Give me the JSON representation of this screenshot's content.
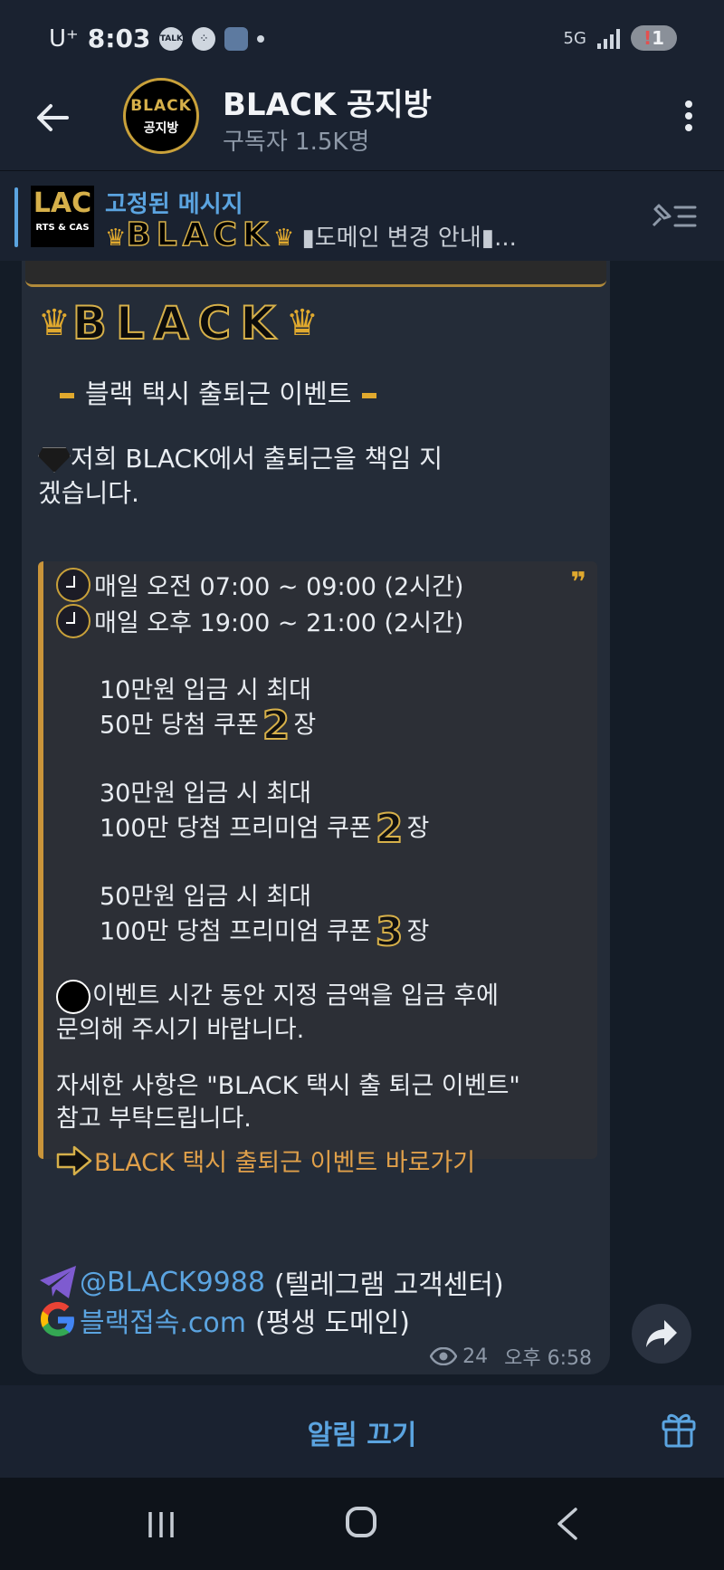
{
  "status_bar": {
    "carrier": "U⁺",
    "time": "8:03",
    "talk_icon": "talk-icon",
    "network": "5G",
    "battery_badge": "!",
    "battery_level": "1"
  },
  "header": {
    "title": "BLACK 공지방",
    "subtitle": "구독자 1.5K명",
    "avatar_brand": "BLACK",
    "avatar_text": "공지방"
  },
  "pinned": {
    "label": "고정된 메시지",
    "thumb_text": "LAC",
    "thumb_sub": "RTS & CAS",
    "crown1": "♛",
    "brand": "BLACK",
    "crown2": "♛",
    "text": "도메인 변경 안내",
    "ellipsis": "..."
  },
  "message": {
    "brand_crown_left": "♛",
    "brand": "BLACK",
    "brand_crown_right": "♛",
    "event_title": "블랙 택시 출퇴근 이벤트",
    "intro": "저희 BLACK에서 출퇴근을 책임 지겠습니다.",
    "quote_mark": "❞",
    "schedule": [
      "매일 오전 07:00 ~ 09:00 (2시간)",
      "매일 오후 19:00 ~ 21:00 (2시간)"
    ],
    "offers": [
      {
        "line1": "10만원 입금 시 최대",
        "line2": "50만 당첨 쿠폰",
        "count": "2",
        "unit": "장"
      },
      {
        "line1": "30만원 입금 시 최대",
        "line2": "100만 당첨 프리미엄 쿠폰",
        "count": "2",
        "unit": "장"
      },
      {
        "line1": "50만원 입금 시 최대",
        "line2": "100만 당첨 프리미엄 쿠폰",
        "count": "3",
        "unit": "장"
      }
    ],
    "notice_1": "이벤트 시간 동안 지정 금액을 입금 후에",
    "notice_2": "문의해 주시기 바랍니다.",
    "detail_1": "자세한 사항은 \"BLACK 택시 출 퇴근 이벤트\"",
    "detail_2": "참고 부탁드립니다.",
    "link_text": "BLACK 택시 출퇴근 이벤트 바로가기",
    "contact_handle": "@BLACK9988",
    "contact_handle_desc": "(텔레그램 고객센터)",
    "contact_domain": "블랙접속.com",
    "contact_domain_desc": "(평생 도메인)",
    "views": "24",
    "time": "오후 6:58"
  },
  "bottom": {
    "mute_label": "알림 끄기"
  },
  "colors": {
    "accent": "#5ba4e0",
    "gold": "#d6b04a",
    "link_orange": "#e0a04a"
  }
}
